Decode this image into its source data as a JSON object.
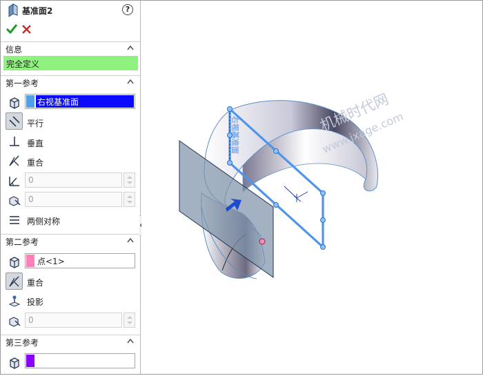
{
  "panel": {
    "title": "基准面2",
    "help_glyph": "?",
    "info_section": "信息",
    "status": "完全定义",
    "first_ref": {
      "section": "第一参考",
      "selection": "右视基准面",
      "swatch_color": "#4f9fe9",
      "options": {
        "parallel": "平行",
        "perpendicular": "垂直",
        "coincident": "重合",
        "symmetric": "两侧对称"
      },
      "angle_value": "0",
      "distance_value": "0"
    },
    "second_ref": {
      "section": "第二参考",
      "selection": "点<1>",
      "swatch_color": "#ff80b8",
      "options": {
        "coincident": "重合",
        "project": "投影"
      },
      "value": "0"
    },
    "third_ref": {
      "section": "第三参考",
      "selection": "",
      "swatch_color": "#8a00ff"
    }
  },
  "viewport": {
    "watermark_cn": "机械时代网",
    "watermark_url": "www.jxage.com",
    "plane_label": "右视基准面"
  }
}
